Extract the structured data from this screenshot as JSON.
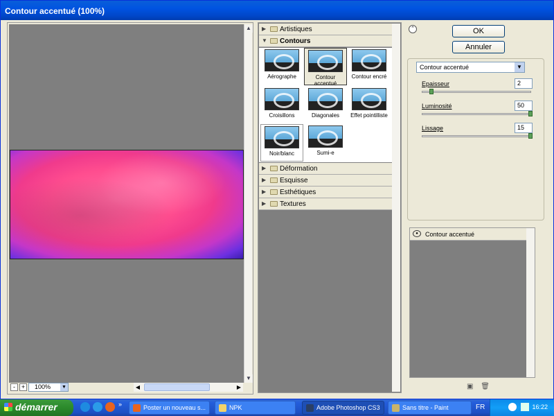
{
  "window": {
    "title": "Contour accentué (100%)"
  },
  "preview": {
    "zoom": "100%",
    "minus_label": "-",
    "plus_label": "+",
    "zoom_dropdown_icon": "chevron-down-icon"
  },
  "filters": {
    "categories": [
      {
        "label": "Artistiques",
        "open": false
      },
      {
        "label": "Contours",
        "open": true
      },
      {
        "label": "Déformation",
        "open": false
      },
      {
        "label": "Esquisse",
        "open": false
      },
      {
        "label": "Esthétiques",
        "open": false
      },
      {
        "label": "Textures",
        "open": false
      }
    ],
    "thumbs": [
      {
        "label": "Aérographe",
        "selected": false
      },
      {
        "label": "Contour accentué",
        "selected": true
      },
      {
        "label": "Contour encré",
        "selected": false
      },
      {
        "label": "Croisillons",
        "selected": false
      },
      {
        "label": "Diagonales",
        "selected": false
      },
      {
        "label": "Effet pointilliste",
        "selected": false
      },
      {
        "label": "Noir/blanc",
        "selected": false
      },
      {
        "label": "Sumi-e",
        "selected": false
      }
    ]
  },
  "controls": {
    "ok_label": "OK",
    "cancel_label": "Annuler",
    "filter_select": "Contour accentué",
    "params": [
      {
        "label": "Epaisseur",
        "value": "2",
        "fraction": 0.09
      },
      {
        "label": "Luminosité",
        "value": "50",
        "fraction": 1.0
      },
      {
        "label": "Lissage",
        "value": "15",
        "fraction": 1.0
      }
    ]
  },
  "layers": {
    "items": [
      {
        "label": "Contour accentué"
      }
    ]
  },
  "taskbar": {
    "start_label": "démarrer",
    "tasks": [
      {
        "label": "Poster un nouveau s...",
        "active": false
      },
      {
        "label": "NPK",
        "active": false
      },
      {
        "label": "Adobe Photoshop CS3",
        "active": true
      },
      {
        "label": "Sans titre - Paint",
        "active": false
      }
    ],
    "language": "FR",
    "clock": "16:22",
    "expand_label": "»"
  },
  "colors": {
    "title_bar": "#0053e1",
    "preview_bg": "#7f7f7f",
    "taskbar": "#245edb",
    "start": "#2b8a2b",
    "knob": "#5da05a"
  }
}
